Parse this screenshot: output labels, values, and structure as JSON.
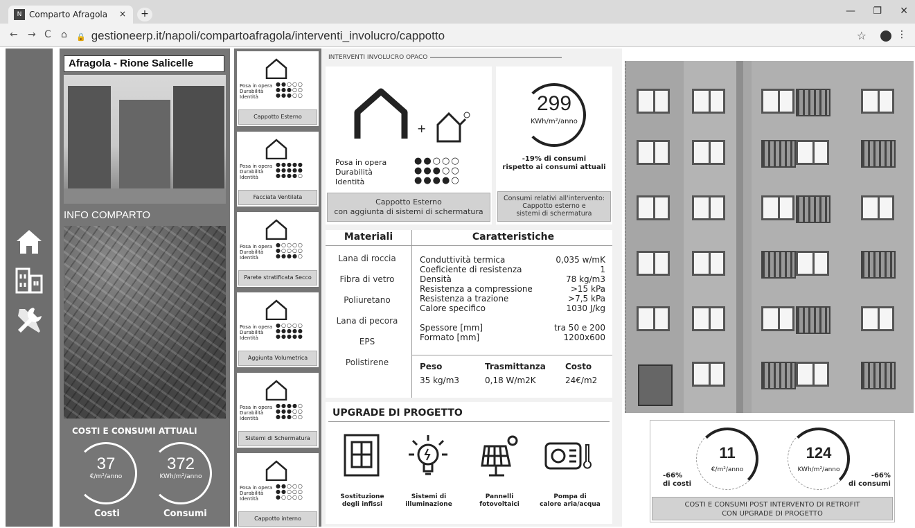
{
  "browser": {
    "tab_title": "Comparto Afragola",
    "tab_close": "×",
    "new_tab": "+",
    "url": "gestioneerp.it/napoli/compartoafragola/interventi_involucro/cappotto",
    "min": "—",
    "max": "❐",
    "close": "✕"
  },
  "sidebar": {
    "icons": [
      "home-icon",
      "buildings-icon",
      "tools-icon"
    ]
  },
  "left": {
    "area_name": "Afragola - Rione Salicelle",
    "info_title": "INFO COMPARTO",
    "cost_title": "COSTI E CONSUMI ATTUALI",
    "cost_value": "37",
    "cost_unit": "€/m²/anno",
    "cost_label": "Costi",
    "cons_value": "372",
    "cons_unit": "KWh/m²/anno",
    "cons_label": "Consumi"
  },
  "options": {
    "row_labels": [
      "Posa in opera",
      "Durabilità",
      "Identità"
    ],
    "items": [
      {
        "label": "Cappotto Esterno",
        "dots": [
          "●●○○○",
          "●●●○○",
          "●●●○○"
        ]
      },
      {
        "label": "Facciata Ventilata",
        "dots": [
          "●●●●●",
          "●●●●●",
          "●●●●○"
        ]
      },
      {
        "label": "Parete stratificata Secco",
        "dots": [
          "●○○○○",
          "●○○○○",
          "●●●●○"
        ]
      },
      {
        "label": "Aggiunta Volumetrica",
        "dots": [
          "●○○○○",
          "●●●●●",
          "●●●●●"
        ]
      },
      {
        "label": "Sistemi di Schermatura",
        "dots": [
          "●●●●○",
          "●●●○○",
          "●●●○○"
        ]
      },
      {
        "label": "Cappotto interno",
        "dots": [
          "●●○○○",
          "●●○○○",
          "●○○○○"
        ]
      }
    ]
  },
  "main": {
    "section_title": "INTERVENTI INVOLUCRO OPACO",
    "plus": "+",
    "rows": [
      "Posa in opera",
      "Durabilità",
      "Identità"
    ],
    "dots": [
      "●●○○○",
      "●●●○○",
      "●●●●○"
    ],
    "intervention_label": "Cappotto Esterno\ncon aggiunta di sistemi di schermatura",
    "consumption_value": "299",
    "consumption_unit": "KWh/m²/anno",
    "consumption_delta": "-19% di consumi\nrispetto ai consumi attuali",
    "consumption_label": "Consumi relativi all'intervento:\nCappotto esterno e\nsistemi di schermatura",
    "materials_header": "Materiali",
    "characteristics_header": "Caratteristiche",
    "materials": [
      "Lana di roccia",
      "Fibra di vetro",
      "Poliuretano",
      "Lana di pecora",
      "EPS",
      "Polistirene"
    ],
    "properties": [
      {
        "k": "Conduttività termica",
        "v": "0,035 w/mK"
      },
      {
        "k": "Coeficiente di resistenza",
        "v": "1"
      },
      {
        "k": "Densità",
        "v": "78 kg/m3"
      },
      {
        "k": "Resistenza a compressione",
        "v": ">15 kPa"
      },
      {
        "k": "Resistenza a trazione",
        "v": ">7,5 kPa"
      },
      {
        "k": "Calore specifico",
        "v": "1030 J/kg"
      }
    ],
    "properties2": [
      {
        "k": "Spessore [mm]",
        "v": "tra 50 e 200"
      },
      {
        "k": "Formato [mm]",
        "v": "1200x600"
      }
    ],
    "peso_h": "Peso",
    "peso_v": "35 kg/m3",
    "trasm_h": "Trasmittanza",
    "trasm_v": "0,18 W/m2K",
    "costo_h": "Costo",
    "costo_v": "24€/m2",
    "upgrade_title": "UPGRADE DI PROGETTO",
    "upgrades": [
      "Sostituzione\ndegli infissi",
      "Sistemi di\nilluminazione",
      "Pannelli\nfotovoltaici",
      "Pompa di\ncalore aria/acqua"
    ]
  },
  "post": {
    "cost_value": "11",
    "cost_unit": "€/m²/anno",
    "cost_pct": "-66%\ndi costi",
    "cons_value": "124",
    "cons_unit": "KWh/m²/anno",
    "cons_pct": "-66%\ndi consumi",
    "label": "COSTI E CONSUMI POST INTERVENTO DI RETROFIT\nCON UPGRADE DI PROGETTO"
  }
}
